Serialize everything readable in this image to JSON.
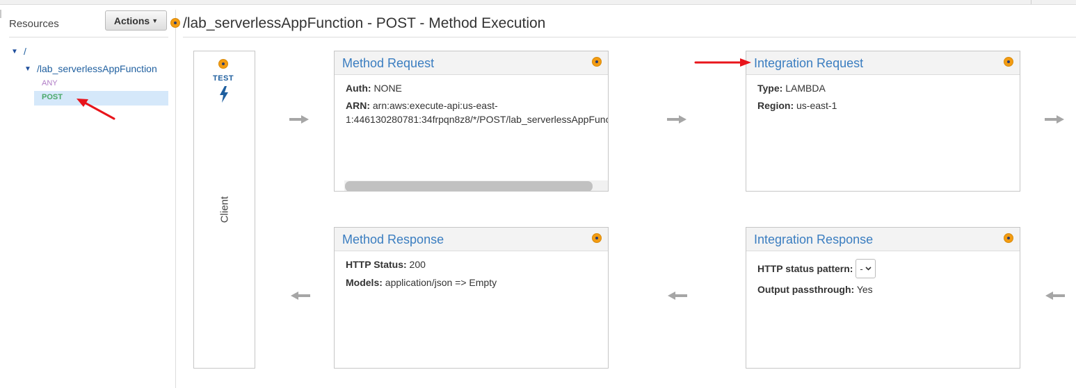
{
  "sidebar": {
    "label": "Resources",
    "actions_label": "Actions",
    "tree": {
      "root": "/",
      "resource": "/lab_serverlessAppFunction",
      "methods": [
        "ANY",
        "POST"
      ]
    }
  },
  "page": {
    "title": "/lab_serverlessAppFunction - POST - Method Execution"
  },
  "client": {
    "test_label": "TEST",
    "label": "Client"
  },
  "method_request": {
    "title": "Method Request",
    "auth_label": "Auth:",
    "auth_value": "NONE",
    "arn_label": "ARN:",
    "arn_value_line1": "arn:aws:execute-api:us-east-",
    "arn_value_line2": "1:446130280781:34frpqn8z8/*/POST/lab_serverlessAppFunc"
  },
  "integration_request": {
    "title": "Integration Request",
    "type_label": "Type:",
    "type_value": "LAMBDA",
    "region_label": "Region:",
    "region_value": "us-east-1"
  },
  "method_response": {
    "title": "Method Response",
    "status_label": "HTTP Status:",
    "status_value": "200",
    "models_label": "Models:",
    "models_value": "application/json => Empty"
  },
  "integration_response": {
    "title": "Integration Response",
    "pattern_label": "HTTP status pattern:",
    "pattern_value": "-",
    "passthrough_label": "Output passthrough:",
    "passthrough_value": "Yes"
  },
  "colors": {
    "link_blue": "#3a7dc0",
    "tree_blue": "#1f5f9f",
    "post_green": "#4aa868",
    "any_purple": "#b07cc6",
    "dot_orange": "#f39c12",
    "annotation_red": "#e8141b",
    "arrow_gray": "#a6a6a6"
  },
  "icons": [
    "chevron-down-icon",
    "orange-dot-icon",
    "lightning-bolt-icon",
    "right-arrow-icon",
    "left-arrow-icon",
    "red-annotation-arrow"
  ]
}
